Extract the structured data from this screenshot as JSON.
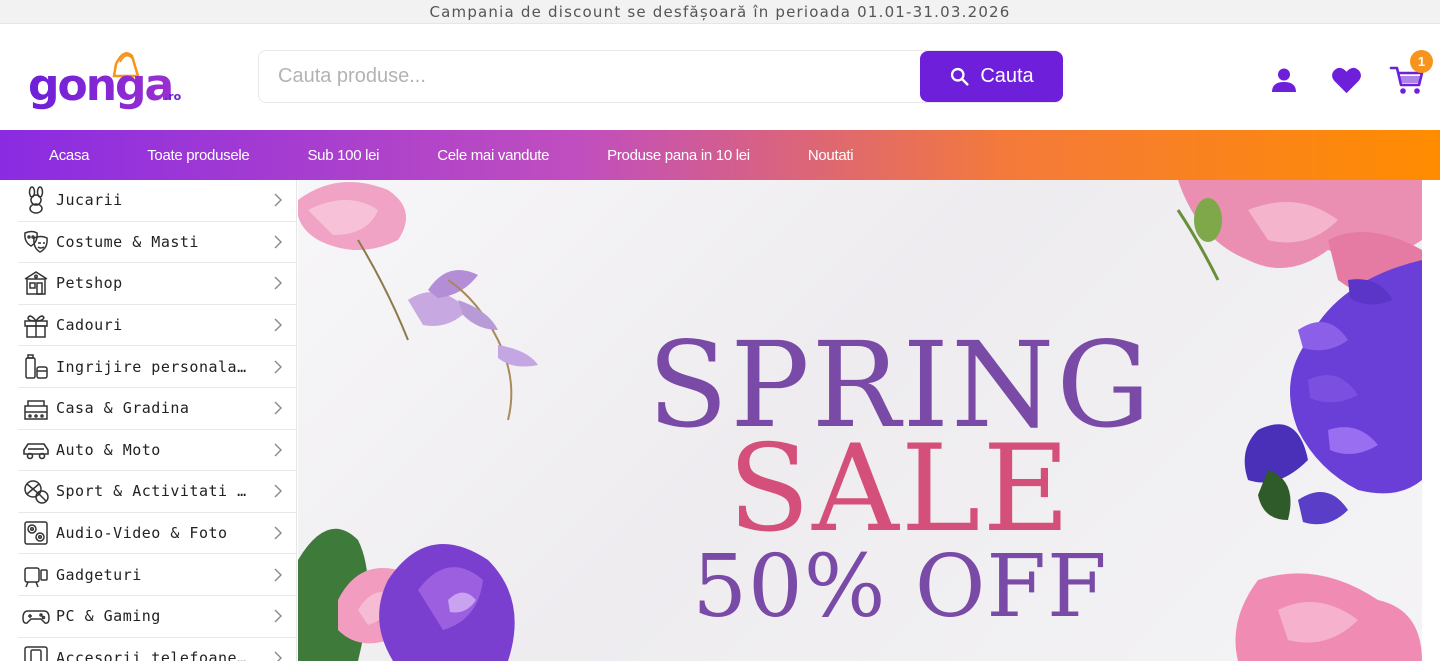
{
  "promo": {
    "text": "Campania de discount se desfășoară în perioada 01.01-31.03.2026"
  },
  "brand": {
    "name": "gonga",
    "tld": ".ro",
    "primary_color": "#6d1fd9",
    "accent_color": "#f7941d"
  },
  "search": {
    "placeholder": "Cauta produse...",
    "button_label": "Cauta"
  },
  "header": {
    "cart_count": "1",
    "icons": [
      "user-icon",
      "heart-icon",
      "cart-icon"
    ]
  },
  "nav": {
    "items": [
      {
        "label": "Acasa"
      },
      {
        "label": "Toate produsele"
      },
      {
        "label": "Sub 100 lei"
      },
      {
        "label": "Cele mai vandute"
      },
      {
        "label": "Produse pana in 10 lei"
      },
      {
        "label": "Noutati"
      }
    ]
  },
  "categories": [
    {
      "label": "Jucarii",
      "icon": "toy-icon"
    },
    {
      "label": "Costume & Masti",
      "icon": "mask-icon"
    },
    {
      "label": "Petshop",
      "icon": "petshop-icon"
    },
    {
      "label": "Cadouri",
      "icon": "gift-icon"
    },
    {
      "label": "Ingrijire personala & Cosmetice",
      "icon": "cosmetics-icon"
    },
    {
      "label": "Casa & Gradina",
      "icon": "home-garden-icon"
    },
    {
      "label": "Auto & Moto",
      "icon": "car-icon"
    },
    {
      "label": "Sport & Activitati in aer liber",
      "icon": "sport-icon"
    },
    {
      "label": "Audio-Video & Foto",
      "icon": "audio-video-icon"
    },
    {
      "label": "Gadgeturi",
      "icon": "gadget-icon"
    },
    {
      "label": "PC & Gaming",
      "icon": "gamepad-icon"
    },
    {
      "label": "Accesorii telefoane & tablete",
      "icon": "phone-icon"
    }
  ],
  "banner": {
    "line1": "SPRING",
    "line2": "SALE",
    "line3": "50% OFF"
  }
}
